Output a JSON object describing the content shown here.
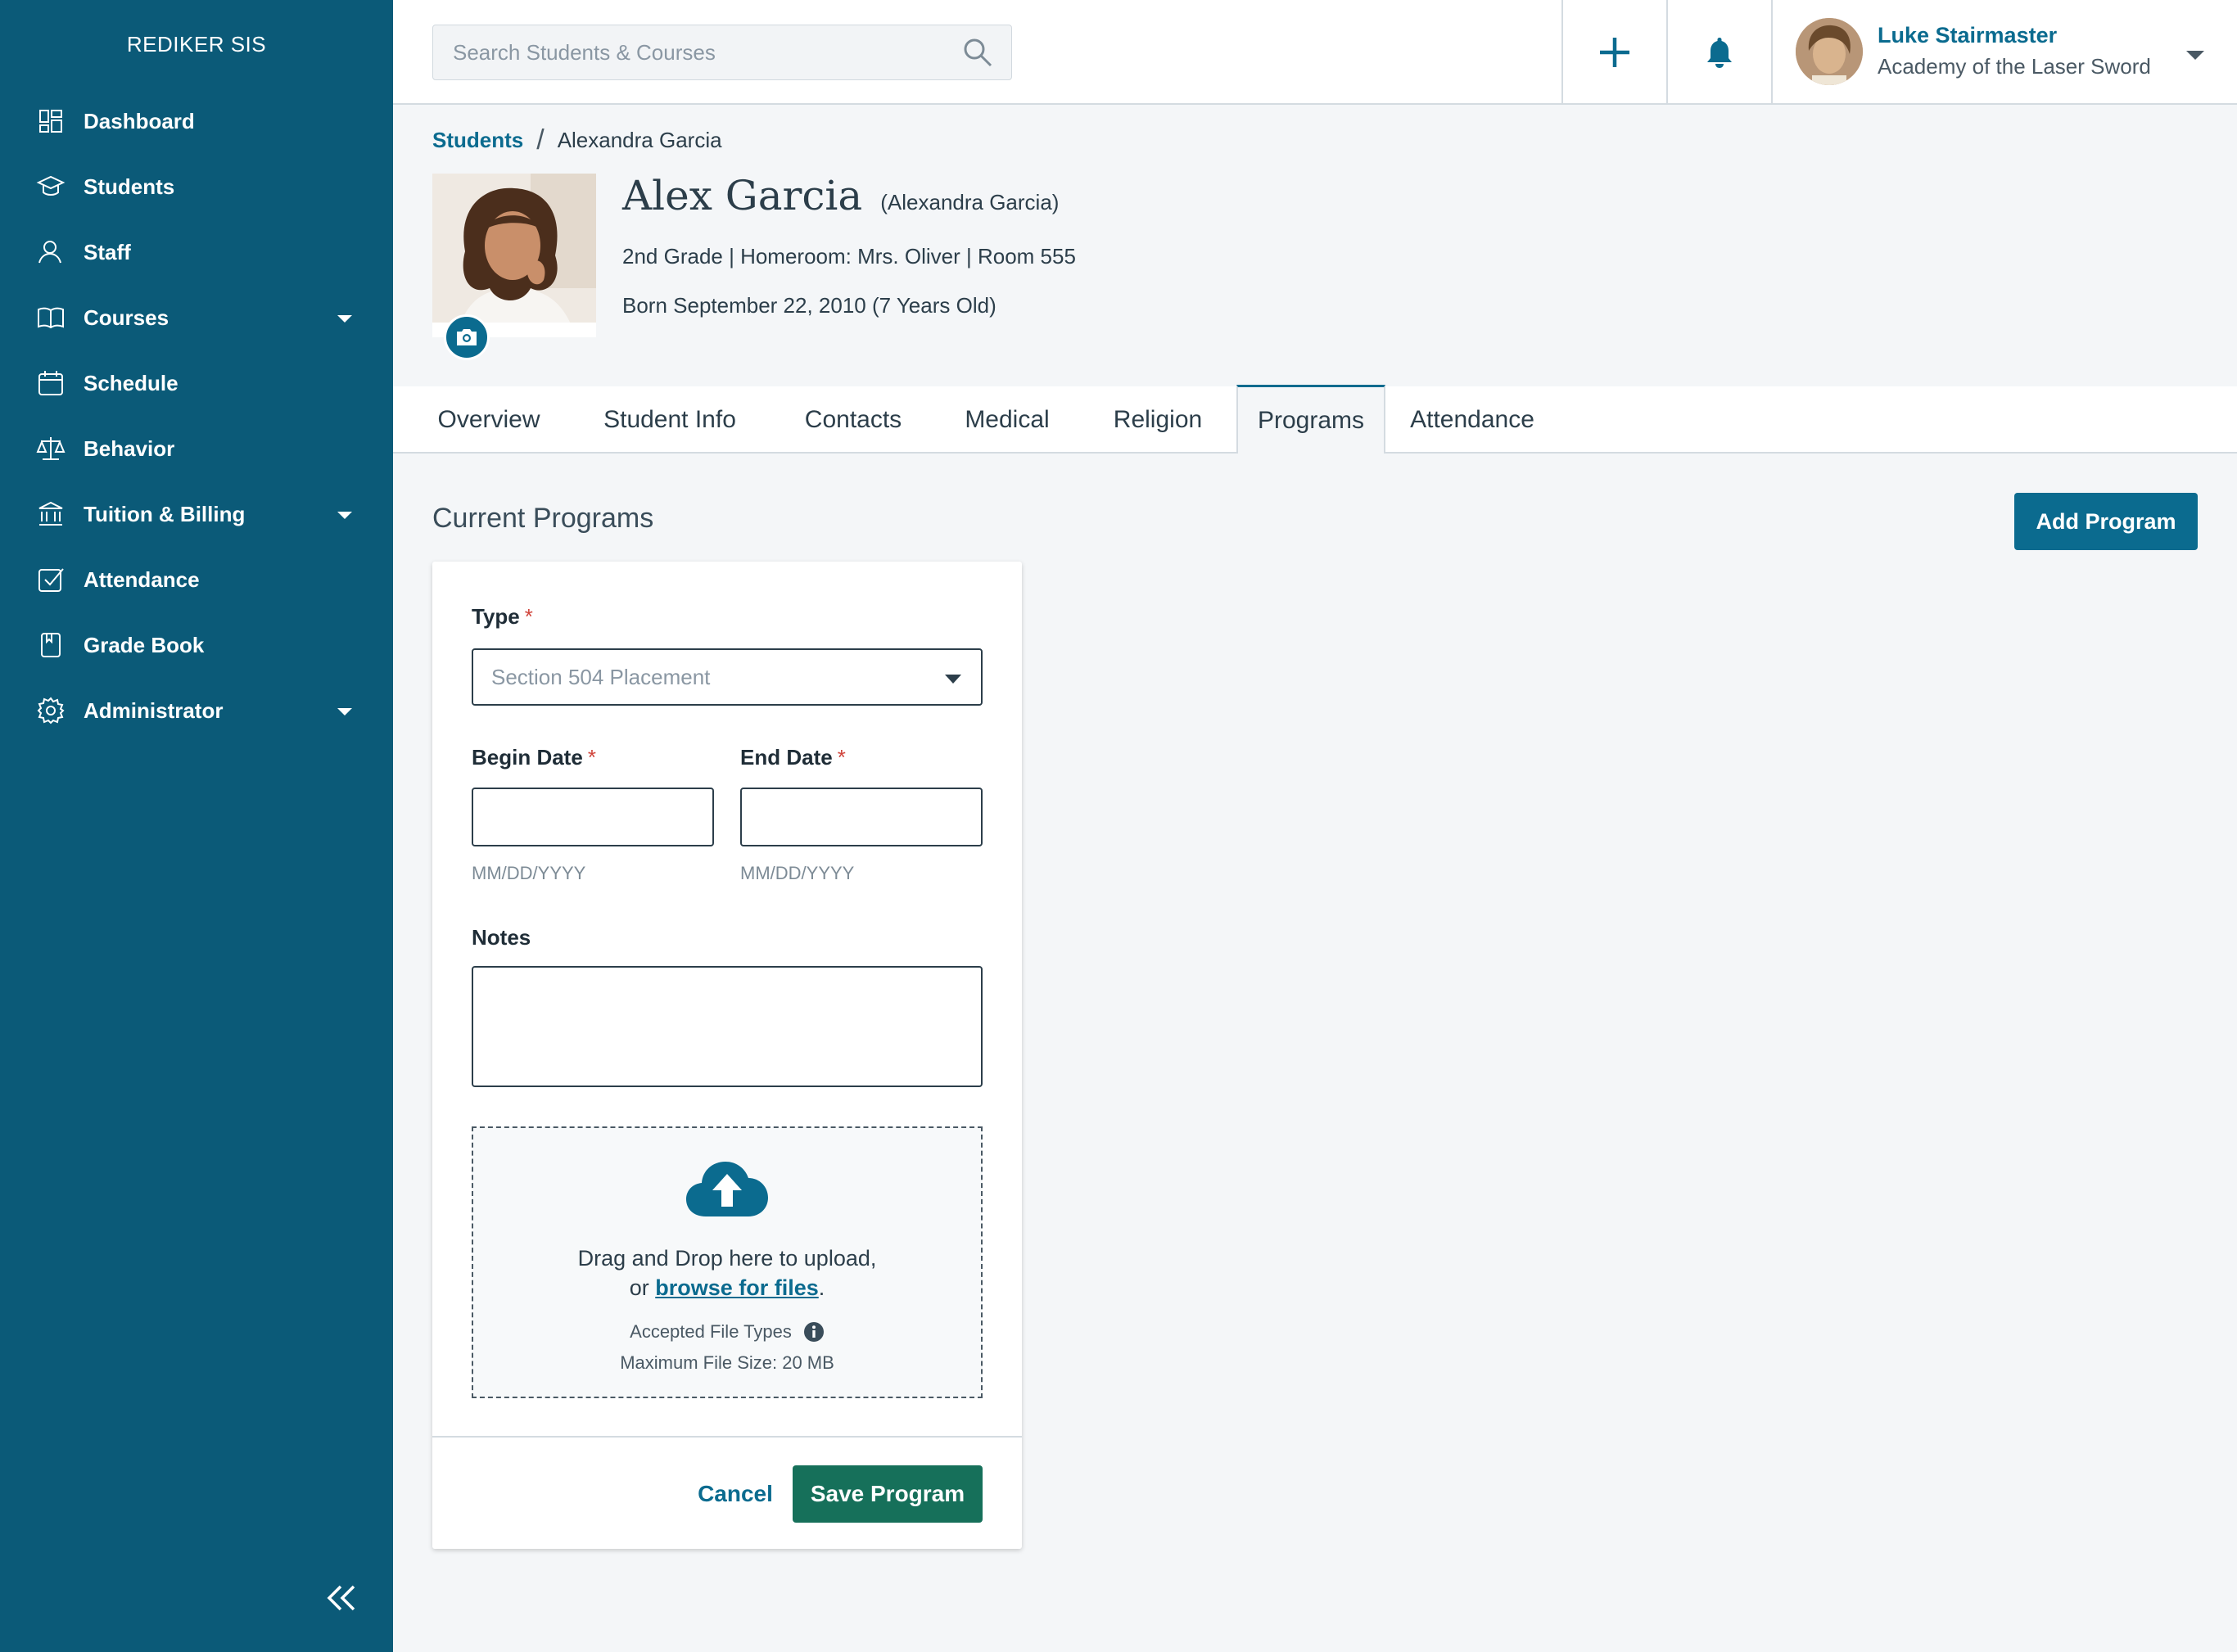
{
  "app": {
    "brand": "REDIKER SIS"
  },
  "sidebar": {
    "items": [
      {
        "label": "Dashboard",
        "icon": "dashboard-icon"
      },
      {
        "label": "Students",
        "icon": "graduation-cap-icon"
      },
      {
        "label": "Staff",
        "icon": "person-icon"
      },
      {
        "label": "Courses",
        "icon": "book-icon",
        "expandable": true
      },
      {
        "label": "Schedule",
        "icon": "calendar-icon"
      },
      {
        "label": "Behavior",
        "icon": "scales-icon"
      },
      {
        "label": "Tuition & Billing",
        "icon": "bank-icon",
        "expandable": true
      },
      {
        "label": "Attendance",
        "icon": "checkbox-icon"
      },
      {
        "label": "Grade Book",
        "icon": "gradebook-icon"
      },
      {
        "label": "Administrator",
        "icon": "gear-icon",
        "expandable": true
      }
    ],
    "collapse_icon": "double-chevron-left-icon"
  },
  "topbar": {
    "search_placeholder": "Search Students & Courses",
    "user_name": "Luke Stairmaster",
    "user_org": "Academy of the Laser Sword"
  },
  "breadcrumb": {
    "root": "Students",
    "current": "Alexandra Garcia"
  },
  "student": {
    "name": "Alex Garcia",
    "legal_name": "(Alexandra Garcia)",
    "details": "2nd Grade | Homeroom: Mrs. Oliver | Room 555",
    "born": "Born September 22, 2010 (7 Years Old)"
  },
  "tabs": [
    {
      "label": "Overview"
    },
    {
      "label": "Student Info"
    },
    {
      "label": "Contacts"
    },
    {
      "label": "Medical"
    },
    {
      "label": "Religion"
    },
    {
      "label": "Programs",
      "active": true
    },
    {
      "label": "Attendance"
    }
  ],
  "section": {
    "title": "Current Programs",
    "add_button": "Add Program"
  },
  "form": {
    "type_label": "Type",
    "type_value": "Section 504 Placement",
    "begin_label": "Begin Date",
    "end_label": "End Date",
    "date_hint": "MM/DD/YYYY",
    "notes_label": "Notes",
    "required_mark": "*",
    "upload": {
      "line1": "Drag and Drop here to upload,",
      "line2_prefix": "or ",
      "browse_link": "browse for files",
      "line2_suffix": ".",
      "accepted": "Accepted File Types",
      "max_size": "Maximum File Size: 20 MB"
    },
    "cancel": "Cancel",
    "save": "Save Program"
  },
  "colors": {
    "sidebar": "#0b5a78",
    "accent": "#0b6b8f",
    "save": "#16705a",
    "required": "#d0443b"
  }
}
